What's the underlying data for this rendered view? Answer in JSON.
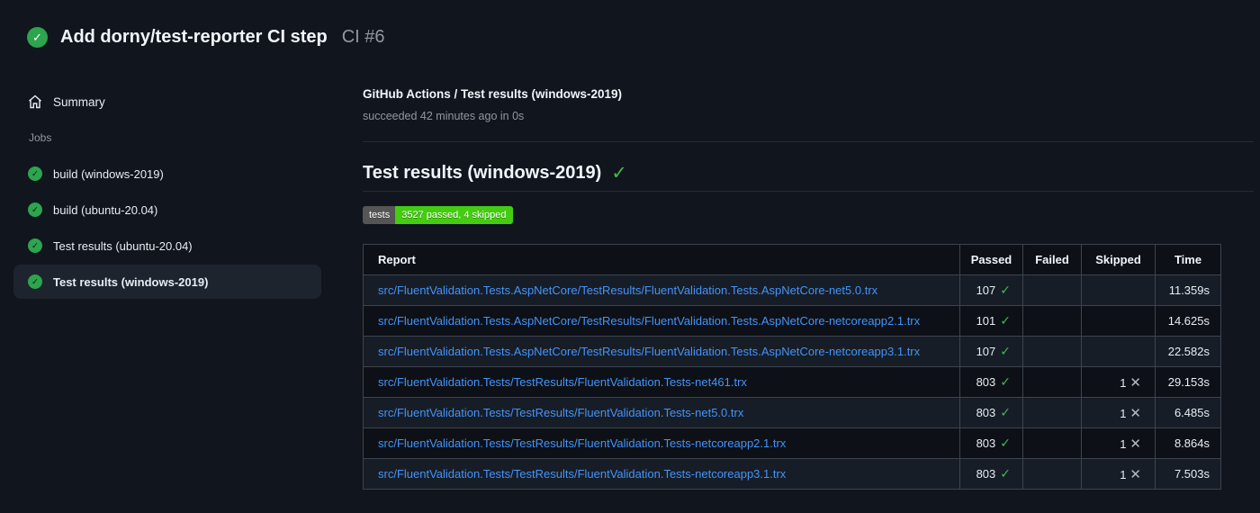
{
  "icons": {
    "check_glyph": "✓",
    "cross_glyph": "✕"
  },
  "colors": {
    "page_bg": "#11151d",
    "success_green": "#2da44e",
    "check_green": "#3fb950",
    "link_blue": "#4493f8",
    "badge_label_bg": "#555555",
    "badge_value_bg": "#44cc11",
    "table_border": "#3d444d"
  },
  "run_header": {
    "title": "Add dorny/test-reporter CI step",
    "run_number": "CI #6"
  },
  "sidebar": {
    "summary_label": "Summary",
    "jobs_label": "Jobs",
    "jobs": [
      {
        "label": "build (windows-2019)",
        "selected": false
      },
      {
        "label": "build (ubuntu-20.04)",
        "selected": false
      },
      {
        "label": "Test results (ubuntu-20.04)",
        "selected": false
      },
      {
        "label": "Test results (windows-2019)",
        "selected": true
      }
    ]
  },
  "main": {
    "check_title": "GitHub Actions / Test results (windows-2019)",
    "check_status": "succeeded 42 minutes ago in 0s",
    "section_title": "Test results (windows-2019)",
    "badge": {
      "label": "tests",
      "value": "3527 passed, 4 skipped"
    },
    "table": {
      "columns": [
        "Report",
        "Passed",
        "Failed",
        "Skipped",
        "Time"
      ],
      "rows": [
        {
          "report": "src/FluentValidation.Tests.AspNetCore/TestResults/FluentValidation.Tests.AspNetCore-net5.0.trx",
          "passed": "107",
          "failed": "",
          "skipped": "",
          "time": "11.359s"
        },
        {
          "report": "src/FluentValidation.Tests.AspNetCore/TestResults/FluentValidation.Tests.AspNetCore-netcoreapp2.1.trx",
          "passed": "101",
          "failed": "",
          "skipped": "",
          "time": "14.625s"
        },
        {
          "report": "src/FluentValidation.Tests.AspNetCore/TestResults/FluentValidation.Tests.AspNetCore-netcoreapp3.1.trx",
          "passed": "107",
          "failed": "",
          "skipped": "",
          "time": "22.582s"
        },
        {
          "report": "src/FluentValidation.Tests/TestResults/FluentValidation.Tests-net461.trx",
          "passed": "803",
          "failed": "",
          "skipped": "1",
          "time": "29.153s"
        },
        {
          "report": "src/FluentValidation.Tests/TestResults/FluentValidation.Tests-net5.0.trx",
          "passed": "803",
          "failed": "",
          "skipped": "1",
          "time": "6.485s"
        },
        {
          "report": "src/FluentValidation.Tests/TestResults/FluentValidation.Tests-netcoreapp2.1.trx",
          "passed": "803",
          "failed": "",
          "skipped": "1",
          "time": "8.864s"
        },
        {
          "report": "src/FluentValidation.Tests/TestResults/FluentValidation.Tests-netcoreapp3.1.trx",
          "passed": "803",
          "failed": "",
          "skipped": "1",
          "time": "7.503s"
        }
      ]
    }
  }
}
